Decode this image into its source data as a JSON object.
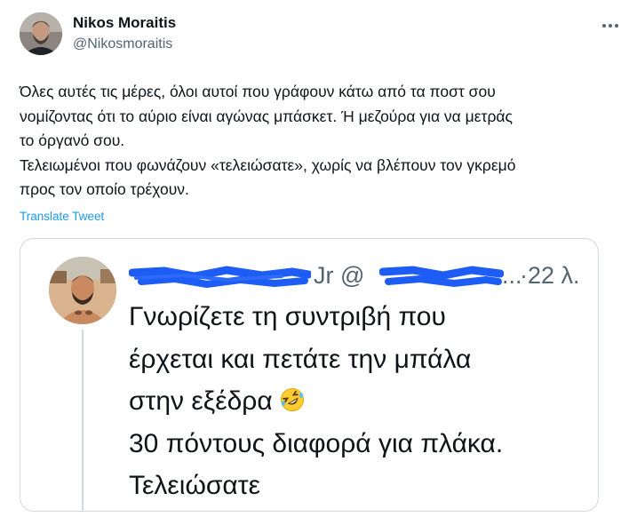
{
  "author": {
    "name": "Nikos Moraitis",
    "handle": "@Nikosmoraitis"
  },
  "tweet": {
    "lines": [
      "Όλες αυτές τις μέρες, όλοι αυτοί που γράφουν κάτω από τα ποστ σου",
      "νομίζοντας ότι το αύριο είναι αγώνας μπάσκετ. Ή μεζούρα για να μετράς",
      "το όργανό σου.",
      "Τελειωμένοι που φωνάζουν «τελειώσατε», χωρίς να βλέπουν τον γκρεμό",
      "προς τον οποίο τρέχουν."
    ],
    "translate_label": "Translate Tweet"
  },
  "quoted": {
    "name_suffix": "Jr @",
    "time": "·22 λ.",
    "ellipsis": "...",
    "lines": [
      "Γνωρίζετε τη συντριβή που",
      "έρχεται και πετάτε την μπάλα",
      "στην εξέδρα",
      "30 πόντους διαφορά για πλάκα.",
      "Τελειώσατε"
    ],
    "emoji": "rolling-on-floor-laughing"
  },
  "colors": {
    "text": "#0f1419",
    "secondary": "#536471",
    "link": "#1d9bf0",
    "border": "#cfd9de",
    "redaction": "#1d5cf5"
  }
}
